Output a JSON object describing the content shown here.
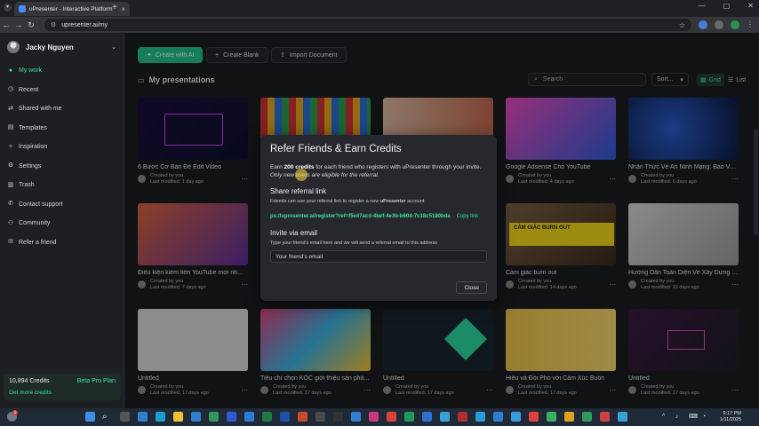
{
  "browser": {
    "tab_title": "uPresenter - Interactive Platform",
    "url": "upresenter.ai/my"
  },
  "sidebar": {
    "user_name": "Jacky Nguyen",
    "items": [
      {
        "label": "My work",
        "icon": "person-icon"
      },
      {
        "label": "Recent",
        "icon": "clock-icon"
      },
      {
        "label": "Shared with me",
        "icon": "share-icon"
      },
      {
        "label": "Templates",
        "icon": "template-icon"
      },
      {
        "label": "Inspiration",
        "icon": "bulb-icon"
      },
      {
        "label": "Settings",
        "icon": "gear-icon"
      },
      {
        "label": "Trash",
        "icon": "trash-icon"
      },
      {
        "label": "Contact support",
        "icon": "support-icon"
      },
      {
        "label": "Community",
        "icon": "community-icon"
      },
      {
        "label": "Refer a friend",
        "icon": "gift-icon"
      }
    ],
    "credits": "10,894 Credits",
    "plan": "Beta Pro Plan",
    "get_more": "Get more credits"
  },
  "toolbar": {
    "create_ai": "Create with AI",
    "create_blank": "Create Blank",
    "import_doc": "Import Document"
  },
  "presentations": {
    "title": "My presentations",
    "search_placeholder": "Search",
    "sort": "Sort...",
    "grid": "Grid",
    "list": "List",
    "created_by": "Created by you",
    "cards": [
      {
        "title": "6 Bước Cơ Bản Để Edit Video",
        "modified": "Last modified: 1 day ago"
      },
      {
        "title": "",
        "modified": ""
      },
      {
        "title": "",
        "modified": ""
      },
      {
        "title": "Google Adsense Cho YouTube",
        "modified": "Last modified: 4 days ago"
      },
      {
        "title": "Nhận Thức Về An Ninh Mạng: Bảo Vệ ...",
        "modified": "Last modified: 6 days ago"
      },
      {
        "title": "Điều kiện kiếm tiền YouTube mới nh...",
        "modified": "Last modified: 7 days ago"
      },
      {
        "title": "Cảm giác burn out",
        "modified": "Last modified: 14 days ago"
      },
      {
        "title": "Hướng Dẫn Toàn Diện Về Xây Dựng v...",
        "modified": "Last modified: 16 days ago"
      },
      {
        "title": "Untitled",
        "modified": "Last modified: 17 days ago"
      },
      {
        "title": "Tiêu chí chọn KOC giới thiệu sản phẩ...",
        "modified": "Last modified: 17 days ago"
      },
      {
        "title": "Untitled",
        "modified": "Last modified: 17 days ago"
      },
      {
        "title": "Hiểu và Đối Phó với Cảm Xúc Buồn",
        "modified": "Last modified: 17 days ago"
      },
      {
        "title": "Untitled",
        "modified": "Last modified: 17 days ago"
      }
    ],
    "burnout_label": "CẢM GIÁC BURN OUT"
  },
  "modal": {
    "title": "Refer Friends & Earn Credits",
    "earn_pre": "Earn ",
    "earn_amount": "200 credits",
    "earn_post": " for each friend who registers with uPresenter through your invite.",
    "note": "Only new users are eligible for the referral.",
    "share_heading": "Share referral link",
    "share_desc_pre": "Friends can use your referral link to register a new ",
    "share_desc_brand": "uPresenter",
    "share_desc_post": " account",
    "referral_link": "ps://upresenter.ai/register?ref=f5e47acd-4bef-4e3b-b60d-7c18c5180bda",
    "copy_link": "Copy link",
    "invite_heading": "Invite via email",
    "invite_desc": "Type your friend's email here and we will send a referral email to this address",
    "email_placeholder": "Your friend's email",
    "close": "Close"
  },
  "taskbar": {
    "time": "6:17 PM",
    "date": "1/11/2025",
    "badge": "1"
  }
}
